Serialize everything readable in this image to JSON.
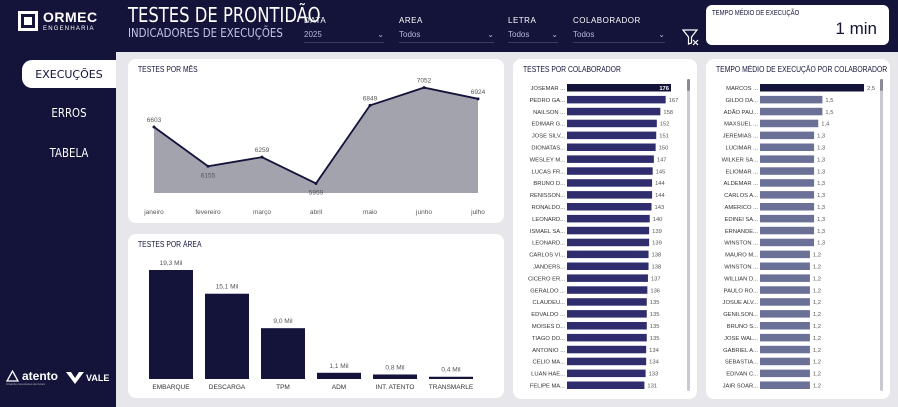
{
  "brand": {
    "name": "ORMEC",
    "tagline": "ENGENHARIA"
  },
  "nav": {
    "items": [
      {
        "label": "EXECUÇÕES"
      },
      {
        "label": "ERROS"
      },
      {
        "label": "TABELA"
      }
    ]
  },
  "partners": {
    "atento": "atento",
    "atento_sub": "Criando conexiones de futuro",
    "vale": "VALE"
  },
  "header": {
    "title": "TESTES DE PRONTIDÃO",
    "subtitle": "INDICADORES DE EXECUÇÕES"
  },
  "filters": {
    "data": {
      "label": "DATA",
      "value": "2025"
    },
    "area": {
      "label": "AREA",
      "value": "Todos"
    },
    "letra": {
      "label": "LETRA",
      "value": "Todos"
    },
    "colaborador": {
      "label": "COLABORADOR",
      "value": "Todos"
    }
  },
  "kpi": {
    "label": "TEMPO MÉDIO DE EXECUÇÃO",
    "value": "1 min"
  },
  "cards": {
    "month": "TESTES POR MÊS",
    "area": "TESTES POR ÁREA",
    "colab": "TESTES POR COLABORADOR",
    "time": "TEMPO MÉDIO DE EXECUÇÃO POR COLABORADOR"
  },
  "colors": {
    "navy": "#14133a",
    "barCount": "#2f2d6e",
    "barTime": "#6b7096",
    "area": "#a3a3ae"
  },
  "chart_data": [
    {
      "type": "area",
      "title": "TESTES POR MÊS",
      "categories": [
        "janeiro",
        "fevereiro",
        "março",
        "abril",
        "maio",
        "junho",
        "julho"
      ],
      "values": [
        6603,
        6155,
        6259,
        5959,
        6849,
        7052,
        6924
      ],
      "labels": [
        "6603",
        "6155",
        "6259",
        "5959",
        "6849",
        "7052",
        "6924"
      ],
      "ylim": [
        5850,
        7150
      ]
    },
    {
      "type": "bar",
      "title": "TESTES POR ÁREA",
      "categories": [
        "EMBARQUE",
        "DESCARGA",
        "TPM",
        "ADM",
        "INT. ATENTO",
        "TRANSMARLE"
      ],
      "values": [
        19.3,
        15.1,
        9.0,
        1.1,
        0.8,
        0.4
      ],
      "labels": [
        "19,3 Mil",
        "15,1 Mil",
        "9,0 Mil",
        "1,1 Mil",
        "0,8 Mil",
        "0,4 Mil"
      ],
      "ylim": [
        0,
        19.3
      ]
    },
    {
      "type": "bar",
      "title": "TESTES POR COLABORADOR",
      "categories": [
        "JOSEMAR ...",
        "PEDRO GA...",
        "NAILSON ...",
        "EDIMAR G...",
        "JOSE SILV...",
        "DIONATAS...",
        "WESLEY M...",
        "LUCAS FR...",
        "BRUNO D...",
        "RENISSON...",
        "RONALDO...",
        "LEONARD...",
        "ISMAEL SA...",
        "LEONARD...",
        "CARLOS VI...",
        "JANDERS...",
        "CICERO ER...",
        "GERALDO ...",
        "CLAUDEU...",
        "EDVALDO ...",
        "MOISES D...",
        "TIAGO DO...",
        "ANTONIO ...",
        "CELIO MA...",
        "LUAN HAE...",
        "FELIPE MA..."
      ],
      "values": [
        176,
        167,
        158,
        152,
        151,
        150,
        147,
        145,
        144,
        144,
        143,
        140,
        139,
        139,
        138,
        138,
        137,
        136,
        135,
        135,
        135,
        135,
        134,
        134,
        133,
        131
      ],
      "xlim": [
        0,
        176
      ]
    },
    {
      "type": "bar",
      "title": "TEMPO MÉDIO DE EXECUÇÃO POR COLABORADOR",
      "categories": [
        "MARCOS ...",
        "GILDO DA...",
        "ADÃO PAU...",
        "MAXSUEL ...",
        "JEREMIAS ...",
        "LUCIMAR ...",
        "WILKER SA...",
        "ELIOMAR ...",
        "ALDEMAR ...",
        "CARLOS A...",
        "AMERICO ...",
        "EDINEI SA...",
        "ERNANDE...",
        "WINSTON ...",
        "MAURO M...",
        "WINSTON ...",
        "WILLIAN D...",
        "PAULO RO...",
        "JOSUE ALV...",
        "GENILSON...",
        "BRUNO S...",
        "JOSE WAL...",
        "GABRIEL A...",
        "SEBASTIA...",
        "EDIVAN C...",
        "JAIR SOAR..."
      ],
      "values": [
        2.5,
        1.5,
        1.5,
        1.4,
        1.3,
        1.3,
        1.3,
        1.3,
        1.3,
        1.3,
        1.3,
        1.3,
        1.3,
        1.3,
        1.2,
        1.2,
        1.2,
        1.2,
        1.2,
        1.2,
        1.2,
        1.2,
        1.2,
        1.2,
        1.2,
        1.2
      ],
      "labels": [
        "2,5",
        "1,5",
        "1,5",
        "1,4",
        "1,3",
        "1,3",
        "1,3",
        "1,3",
        "1,3",
        "1,3",
        "1,3",
        "1,3",
        "1,3",
        "1,3",
        "1,2",
        "1,2",
        "1,2",
        "1,2",
        "1,2",
        "1,2",
        "1,2",
        "1,2",
        "1,2",
        "1,2",
        "1,2",
        "1,2"
      ],
      "xlim": [
        0,
        2.5
      ]
    }
  ]
}
